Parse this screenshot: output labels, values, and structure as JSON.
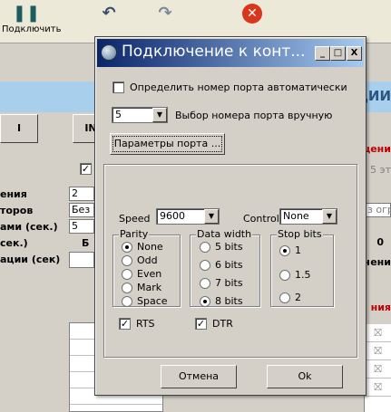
{
  "app": {
    "toolbar": {
      "connect_label": "Подключить",
      "undo_icon": "undo-icon",
      "redo_icon": "redo-icon",
      "close_icon": "close-icon"
    },
    "header_right": "ЦИИ",
    "frame_button_left": "I",
    "frame_button_in": "IN",
    "labels": [
      "ения",
      "торов",
      "ами (сек.)",
      "сек.)",
      "ации (сек)"
    ],
    "fields": [
      "2",
      "Без",
      "5",
      "Б"
    ],
    "right_texts": {
      "red1": "щени",
      "gray1": "5 эт",
      "gray2": "з огр",
      "bold1": "0",
      "bold2": "чени",
      "red2": "ния"
    },
    "grid_rows": 6,
    "right_cells": [
      "⛝",
      "⛝",
      "⛝",
      "⛝"
    ]
  },
  "dialog": {
    "title": "Подключение к конт...",
    "title_buttons": {
      "minimize": "_",
      "maximize": "□",
      "close": "X"
    },
    "auto_port_label": "Определить номер порта автоматически",
    "auto_port_checked": false,
    "port_value": "5",
    "manual_port_label": "Выбор номера порта вручную",
    "port_params_button": "Параметры порта ...",
    "speed_label": "Speed",
    "speed_value": "9600",
    "control_label": "Control",
    "control_value": "None",
    "parity": {
      "legend": "Parity",
      "options": [
        "None",
        "Odd",
        "Even",
        "Mark",
        "Space"
      ],
      "selected": "None"
    },
    "data_width": {
      "legend": "Data width",
      "options": [
        "5 bits",
        "6 bits",
        "7 bits",
        "8 bits"
      ],
      "selected": "8 bits"
    },
    "stop_bits": {
      "legend": "Stop bits",
      "options": [
        "1",
        "1.5",
        "2"
      ],
      "selected": "1"
    },
    "rts_label": "RTS",
    "rts_checked": true,
    "dtr_label": "DTR",
    "dtr_checked": true,
    "cancel_button": "Отмена",
    "ok_button": "Ok"
  }
}
